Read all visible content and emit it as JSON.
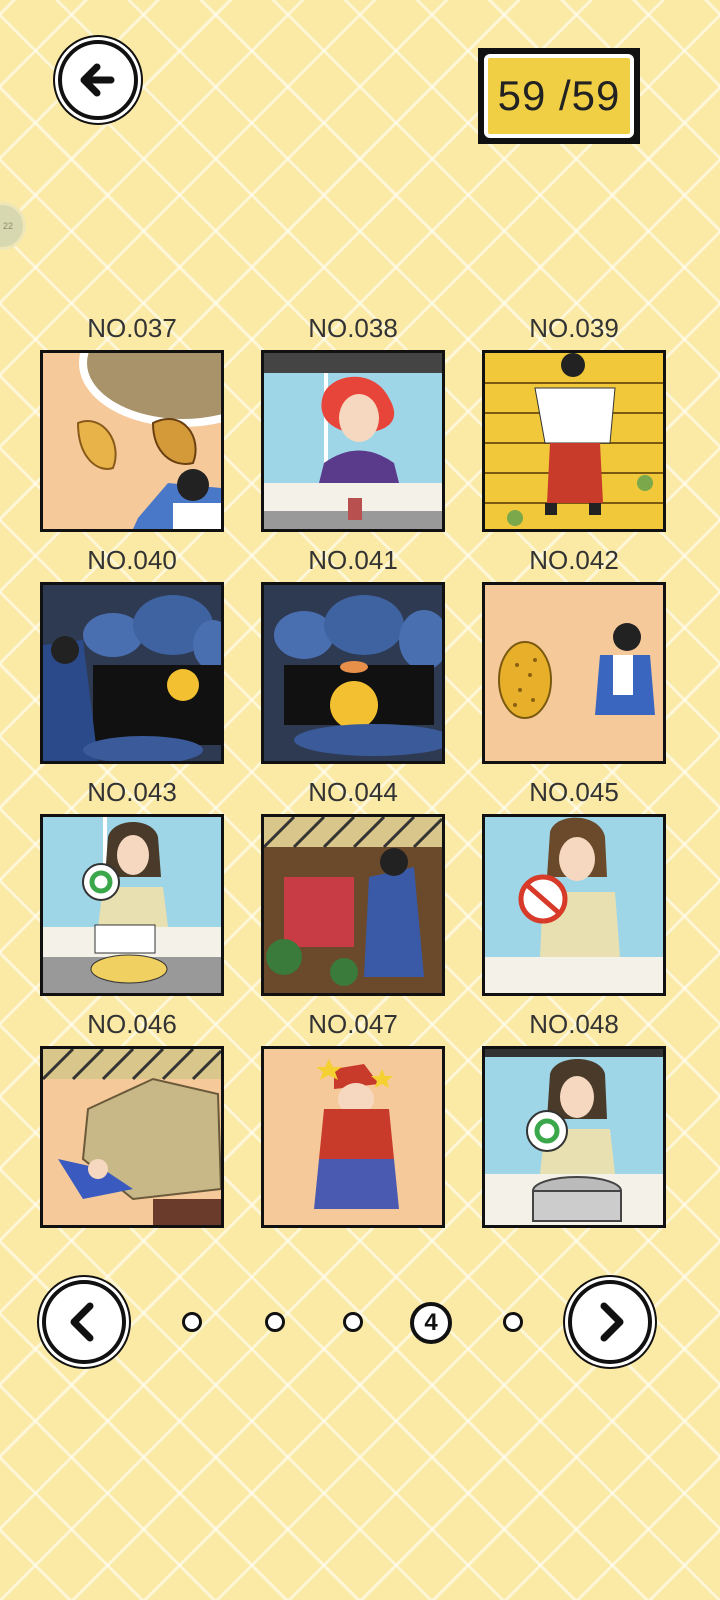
{
  "header": {
    "counter_text": "59 /59",
    "side_tab_text": "22"
  },
  "gallery": {
    "items": [
      {
        "label": "NO.037",
        "scene": "croissants"
      },
      {
        "label": "NO.038",
        "scene": "redhead-confused"
      },
      {
        "label": "NO.039",
        "scene": "stage-robe"
      },
      {
        "label": "NO.040",
        "scene": "night-pond"
      },
      {
        "label": "NO.041",
        "scene": "night-moon"
      },
      {
        "label": "NO.042",
        "scene": "durian"
      },
      {
        "label": "NO.043",
        "scene": "girl-sign-book"
      },
      {
        "label": "NO.044",
        "scene": "watermelon-dance"
      },
      {
        "label": "NO.045",
        "scene": "girl-no-sign"
      },
      {
        "label": "NO.046",
        "scene": "boulder"
      },
      {
        "label": "NO.047",
        "scene": "plumber-dizzy"
      },
      {
        "label": "NO.048",
        "scene": "girl-sign-pot"
      }
    ]
  },
  "pager": {
    "active_page": "4",
    "total_pages": 5
  },
  "icons": {
    "back": "arrow-left-icon",
    "prev": "chevron-left-icon",
    "next": "chevron-right-icon"
  }
}
